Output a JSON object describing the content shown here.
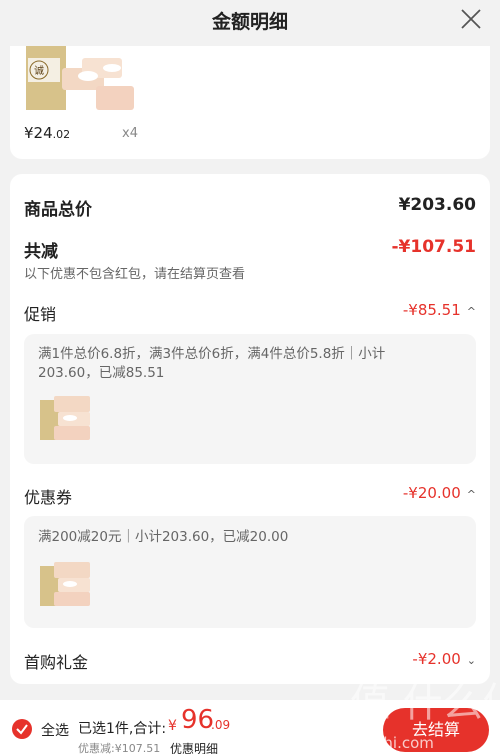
{
  "header": {
    "title": "金额明细",
    "close_icon": "close-icon"
  },
  "product": {
    "price_currency": "¥",
    "price_int": "24",
    "price_dec": ".02",
    "quantity": "x4",
    "brand_mark": "诚"
  },
  "summary": {
    "goods_total_label": "商品总价",
    "goods_total_value": "¥203.60",
    "total_reduced_label": "共减",
    "total_reduced_value": "-¥107.51",
    "note": "以下优惠不包含红包，请在结算页查看"
  },
  "promotion": {
    "label": "促销",
    "value": "-¥85.51",
    "desc_line1": "满1件总价6.8折，满3件总价6折，满4件总价5.8折｜小计",
    "desc_line2": "203.60，已减85.51"
  },
  "coupon": {
    "label": "优惠券",
    "value": "-¥20.00",
    "desc": "满200减20元｜小计203.60，已减20.00"
  },
  "first_purchase": {
    "label": "首购礼金",
    "value": "-¥2.00"
  },
  "bottom_bar": {
    "select_all": "全选",
    "selected_total": "已选1件,合计:",
    "total_currency": "¥",
    "total_int": "96",
    "total_dec": ".09",
    "discount_line": "优惠减:¥107.51",
    "detail_link": "优惠明细",
    "checkout": "去结算"
  },
  "colors": {
    "accent": "#e6322b",
    "background": "#f2f2f2",
    "card": "#ffffff"
  },
  "watermark": {
    "text": "值 什么值得买",
    "url_text": "zhizhi.com"
  }
}
